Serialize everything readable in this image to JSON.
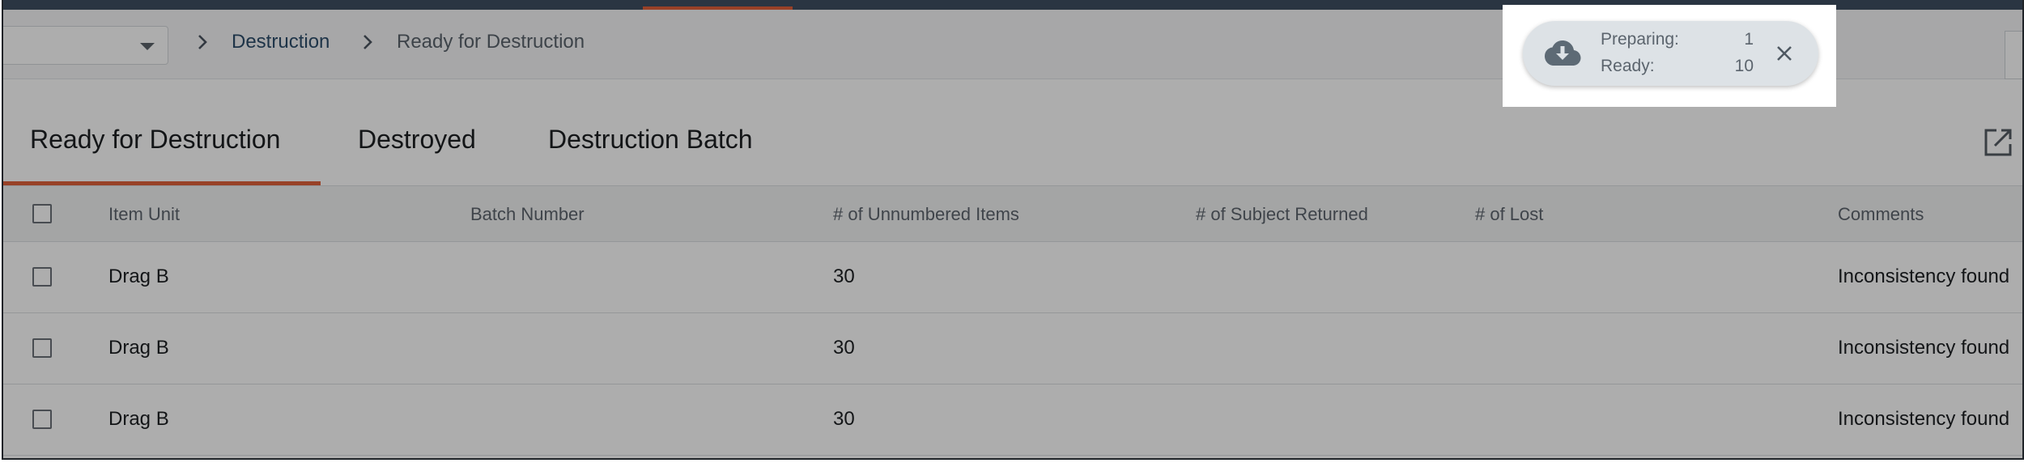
{
  "breadcrumb": {
    "context_value": "",
    "items": [
      "Destruction",
      "Ready for Destruction"
    ]
  },
  "tabs": [
    {
      "label": "Ready for Destruction",
      "active": true
    },
    {
      "label": "Destroyed",
      "active": false
    },
    {
      "label": "Destruction Batch",
      "active": false
    }
  ],
  "table": {
    "columns": [
      "Item Unit",
      "Batch Number",
      "# of Unnumbered Items",
      "# of Subject Returned",
      "# of Lost",
      "Comments"
    ],
    "rows": [
      {
        "item_unit": "Drag B",
        "batch_number": "",
        "unnumbered": "30",
        "subject_returned": "",
        "lost": "",
        "comments": "Inconsistency found"
      },
      {
        "item_unit": "Drag B",
        "batch_number": "",
        "unnumbered": "30",
        "subject_returned": "",
        "lost": "",
        "comments": "Inconsistency found"
      },
      {
        "item_unit": "Drag B",
        "batch_number": "",
        "unnumbered": "30",
        "subject_returned": "",
        "lost": "",
        "comments": "Inconsistency found"
      }
    ]
  },
  "download_status": {
    "preparing_label": "Preparing:",
    "preparing_count": "1",
    "ready_label": "Ready:",
    "ready_count": "10",
    "icon": "cloud-download-icon"
  },
  "icons": {
    "breadcrumb_separator": "chevron-right-icon",
    "dropdown": "caret-down-icon",
    "external": "external-link-icon",
    "close": "close-icon"
  },
  "colors": {
    "accent": "#e0603a",
    "topbar": "#3e4f62",
    "link": "#2d4d6b"
  }
}
